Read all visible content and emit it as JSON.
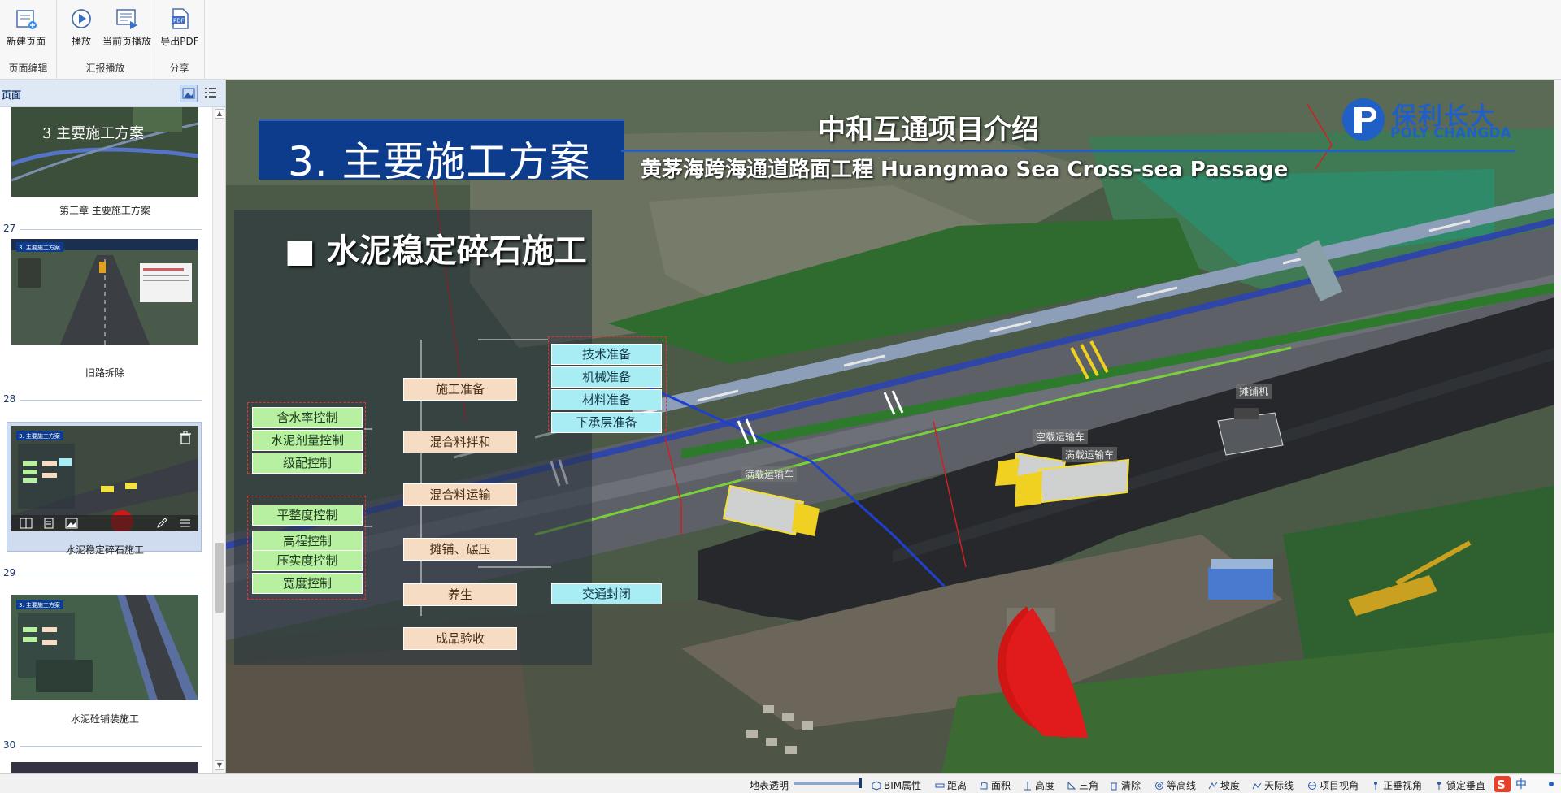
{
  "ribbon": {
    "groups": [
      {
        "label": "页面编辑",
        "buttons": [
          {
            "label": "新建页面"
          }
        ]
      },
      {
        "label": "汇报播放",
        "buttons": [
          {
            "label": "播放"
          },
          {
            "label": "当前页播放"
          }
        ]
      },
      {
        "label": "分享",
        "buttons": [
          {
            "label": "导出PDF"
          }
        ]
      }
    ]
  },
  "pages_panel": {
    "title": "页面",
    "pages": [
      {
        "number": "",
        "caption": "第三章 主要施工方案",
        "thumb_text": "3 主要施工方案"
      },
      {
        "number": "27",
        "caption": "旧路拆除",
        "thumb_text": "3. 主要施工方案"
      },
      {
        "number": "28",
        "caption": "水泥稳定碎石施工",
        "thumb_text": "3. 主要施工方案",
        "selected": true
      },
      {
        "number": "29",
        "caption": "水泥砼铺装施工",
        "thumb_text": "3. 主要施工方案"
      },
      {
        "number": "30",
        "caption": "",
        "thumb_text": ""
      }
    ]
  },
  "slide": {
    "section_title": "3. 主要施工方案",
    "header_title": "中和互通项目介绍",
    "header_subtitle": "黄茅海跨海通道路面工程 Huangmao Sea Cross-sea Passage",
    "logo_cn": "保利长大",
    "logo_en": "POLY CHANGDA",
    "sub_title": "■ 水泥稳定碎石施工",
    "green_boxes": [
      "含水率控制",
      "水泥剂量控制",
      "级配控制",
      "平整度控制",
      "高程控制",
      "压实度控制",
      "宽度控制"
    ],
    "orange_boxes": [
      "施工准备",
      "混合料拌和",
      "混合料运输",
      "摊铺、碾压",
      "养生",
      "成品验收"
    ],
    "cyan_boxes": [
      "技术准备",
      "机械准备",
      "材料准备",
      "下承层准备",
      "交通封闭"
    ],
    "vehicle_labels": [
      "满载运输车",
      "空载运输车",
      "满载运输车",
      "摊铺机"
    ]
  },
  "statusbar": {
    "items": [
      "地表透明",
      "BIM属性",
      "距离",
      "面积",
      "高度",
      "三角",
      "清除",
      "等高线",
      "坡度",
      "天际线",
      "项目视角",
      "正垂视角",
      "锁定垂直"
    ],
    "ime": "中"
  },
  "colors": {
    "accent": "#0d3c8c",
    "brand": "#1f5fc6",
    "green_box": "#b7f0a0",
    "orange_box": "#f5dcc2",
    "cyan_box": "#a8ecf4"
  }
}
